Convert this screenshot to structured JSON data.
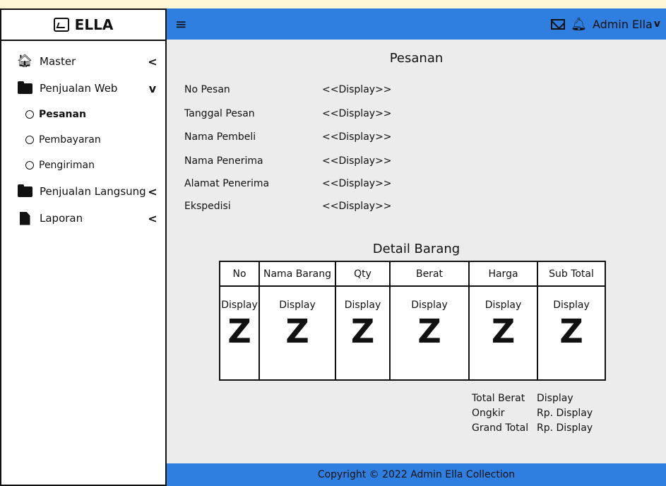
{
  "app": {
    "brand": "ELLA"
  },
  "sidebar": {
    "items": [
      {
        "label": "Master",
        "icon": "home-icon",
        "chevron": "<"
      },
      {
        "label": "Penjualan Web",
        "icon": "folder-icon",
        "chevron": "v",
        "children": [
          {
            "label": "Pesanan",
            "active": true
          },
          {
            "label": "Pembayaran",
            "active": false
          },
          {
            "label": "Pengiriman",
            "active": false
          }
        ]
      },
      {
        "label": "Penjualan Langsung",
        "icon": "folder-icon",
        "chevron": "<"
      },
      {
        "label": "Laporan",
        "icon": "document-icon",
        "chevron": "<"
      }
    ]
  },
  "topbar": {
    "menu_icon": "≡",
    "user_name": "Admin Ella"
  },
  "main": {
    "title": "Pesanan",
    "fields": [
      {
        "label": "No Pesan",
        "value": "<<Display>>"
      },
      {
        "label": "Tanggal Pesan",
        "value": "<<Display>>"
      },
      {
        "label": "Nama Pembeli",
        "value": "<<Display>>"
      },
      {
        "label": "Nama Penerima",
        "value": "<<Display>>"
      },
      {
        "label": "Alamat Penerima",
        "value": "<<Display>>"
      },
      {
        "label": "Ekspedisi",
        "value": "<<Display>>"
      }
    ],
    "detail_title": "Detail Barang",
    "table": {
      "columns": [
        "No",
        "Nama Barang",
        "Qty",
        "Berat",
        "Harga",
        "Sub Total"
      ],
      "cell_text": "Display",
      "scroll_glyph": "Z"
    },
    "totals": [
      {
        "label": "Total Berat",
        "value": "Display"
      },
      {
        "label": "Ongkir",
        "value": "Rp. Display"
      },
      {
        "label": "Grand Total",
        "value": "Rp. Display"
      }
    ]
  },
  "footer": {
    "text": "Copyright © 2022 Admin Ella Collection"
  },
  "colors": {
    "accent": "#2f7fe0",
    "content_bg": "#ececec"
  }
}
